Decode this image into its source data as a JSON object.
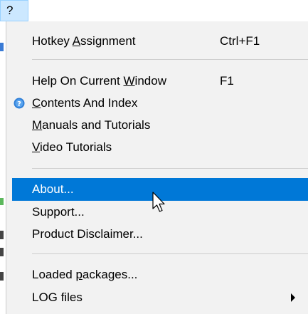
{
  "menubar": {
    "item_label": "?"
  },
  "menu": {
    "items": [
      {
        "label_pre": "Hotkey ",
        "label_ul": "A",
        "label_post": "ssignment",
        "shortcut": "Ctrl+F1"
      },
      {
        "label_pre": "Help On Current ",
        "label_ul": "W",
        "label_post": "indow",
        "shortcut": "F1"
      },
      {
        "label_pre": "",
        "label_ul": "C",
        "label_post": "ontents And Index",
        "shortcut": "",
        "icon": "help-circle-icon"
      },
      {
        "label_pre": "",
        "label_ul": "M",
        "label_post": "anuals and Tutorials",
        "shortcut": ""
      },
      {
        "label_pre": "",
        "label_ul": "V",
        "label_post": "ideo Tutorials",
        "shortcut": ""
      },
      {
        "label_pre": "About...",
        "label_ul": "",
        "label_post": "",
        "shortcut": "",
        "highlighted": true
      },
      {
        "label_pre": "Support...",
        "label_ul": "",
        "label_post": "",
        "shortcut": ""
      },
      {
        "label_pre": "Product Disclaimer...",
        "label_ul": "",
        "label_post": "",
        "shortcut": ""
      },
      {
        "label_pre": "Loaded ",
        "label_ul": "p",
        "label_post": "ackages...",
        "shortcut": ""
      },
      {
        "label_pre": "LOG files",
        "label_ul": "",
        "label_post": "",
        "shortcut": "",
        "submenu": true
      }
    ]
  },
  "colors": {
    "menu_bg": "#f2f2f2",
    "highlight_bg": "#0078d7",
    "highlight_fg": "#ffffff",
    "menubar_hover": "#cce8ff"
  }
}
